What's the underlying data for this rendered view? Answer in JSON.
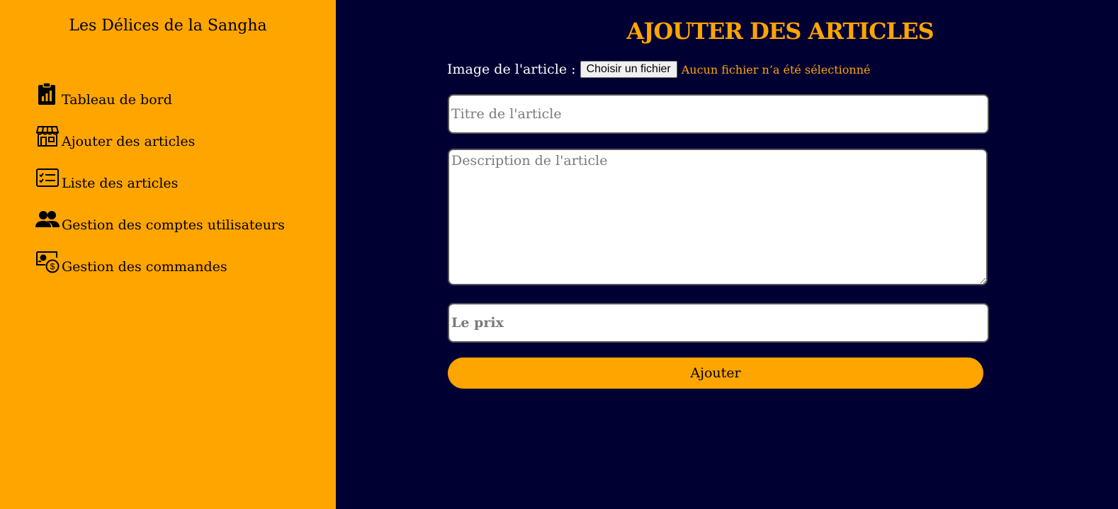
{
  "sidebar": {
    "brand": "Les Délices de la Sangha",
    "items": [
      {
        "label": "Tableau de bord",
        "icon": "clipboard-chart-icon"
      },
      {
        "label": "Ajouter des articles",
        "icon": "store-icon"
      },
      {
        "label": "Liste des articles",
        "icon": "checklist-icon"
      },
      {
        "label": "Gestion des comptes utilisateurs",
        "icon": "users-icon"
      },
      {
        "label": "Gestion des commandes",
        "icon": "money-icon"
      }
    ]
  },
  "main": {
    "title": "AJOUTER DES ARTICLES",
    "image_label": "Image de l'article :",
    "file_button": "Choisir un fichier",
    "file_status": "Aucun fichier n’a été sélectionné",
    "title_placeholder": "Titre de l'article",
    "description_placeholder": "Description de l'article",
    "price_placeholder": "Le prix",
    "submit_label": "Ajouter"
  },
  "colors": {
    "accent": "#FFA500",
    "background": "#000033",
    "text_light": "#FFFFFF"
  }
}
